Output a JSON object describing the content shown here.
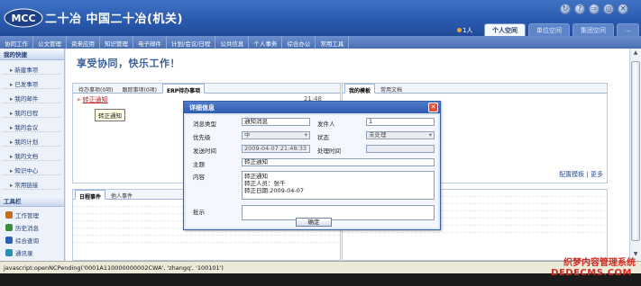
{
  "header": {
    "logo_text": "MCC",
    "title": "二十冶 中国二十冶(机关)",
    "user_count": "1人",
    "tabs": [
      {
        "label": "个人空间",
        "active": true
      },
      {
        "label": "单位空间",
        "active": false
      },
      {
        "label": "集团空间",
        "active": false
      },
      {
        "label": "...",
        "active": false
      }
    ],
    "buttons": [
      "↻",
      "?",
      "⇨",
      "◎",
      "✕"
    ]
  },
  "nav": {
    "items": [
      "协同工作",
      "公文管理",
      "资来应用",
      "知识管理",
      "电子邮件",
      "计划/会议/日程",
      "公共信息",
      "个人事务",
      "综合办公",
      "常用工具"
    ]
  },
  "sidebar": {
    "title": "我的快捷",
    "items": [
      "新建事项",
      "已发事项",
      "我的邮件",
      "我的日程",
      "我的会议",
      "我的计划",
      "我的文档",
      "知识中心",
      "常用链接"
    ],
    "tools_title": "工具栏",
    "tools": [
      {
        "label": "工作管理",
        "icon": "briefcase-icon",
        "color": "#c46b1c"
      },
      {
        "label": "历史消息",
        "icon": "history-icon",
        "color": "#3a8f3a"
      },
      {
        "label": "综合查询",
        "icon": "search-icon",
        "color": "#2b62b8"
      },
      {
        "label": "通讯录",
        "icon": "contacts-icon",
        "color": "#2a8fb8"
      }
    ]
  },
  "main": {
    "slogan": "享受协同，快乐工作！",
    "pending_tabs": [
      "待办事项(0项)",
      "跟踪事项(0项)",
      "ERP待办事项"
    ],
    "pending_item": "转正通知",
    "pending_time": "21:48",
    "tooltip": "转正通知",
    "template_tabs": [
      "我的模板",
      "常用文档"
    ],
    "template_links": "配置模板 | 更多",
    "calendar_tabs": [
      "日程事件",
      "他人事件"
    ]
  },
  "modal": {
    "title": "详细信息",
    "fields": {
      "msg_type_label": "消息类型",
      "msg_type": "通知消息",
      "sender_label": "发件人",
      "sender": "1",
      "priority_label": "优先级",
      "priority": "中",
      "status_label": "状态",
      "status": "未处理",
      "send_time_label": "发送时间",
      "send_time": "2009-04-07 21:48:33",
      "handle_time_label": "处理时间",
      "handle_time": "",
      "subject_label": "主题",
      "subject": "转正通知",
      "content_label": "内容",
      "content_line1": "转正通知",
      "content_line2": "转正人员：张千",
      "content_line3": "转正日期:2009-04-07",
      "comment_label": "批示"
    },
    "ok_label": "确定"
  },
  "status_bar": {
    "text": "javascript:openNCPending('0001A110000000002CWA', 'zhangq', '100101')"
  },
  "watermark": {
    "line1": "织梦内容管理系统",
    "line2": "DEDECMS.COM"
  }
}
